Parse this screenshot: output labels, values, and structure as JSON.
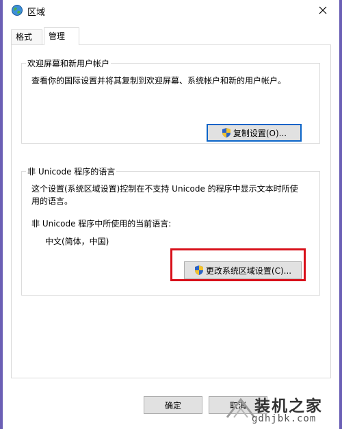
{
  "window": {
    "title": "区域"
  },
  "tabs": [
    {
      "label": "格式"
    },
    {
      "label": "管理"
    }
  ],
  "welcome_group": {
    "legend": "欢迎屏幕和新用户帐户",
    "description": "查看你的国际设置并将其复制到欢迎屏幕、系统帐户和新的用户帐户。",
    "copy_button": "复制设置(O)..."
  },
  "unicode_group": {
    "legend": "非 Unicode 程序的语言",
    "description_line1": "这个设置(系统区域设置)控制在不支持 Unicode 的程序中显示文本时所使",
    "description_line2": "用的语言。",
    "current_label": "非 Unicode 程序中所使用的当前语言:",
    "current_value": "中文(简体，中国)",
    "change_button": "更改系统区域设置(C)..."
  },
  "footer": {
    "ok": "确定",
    "cancel": "取消"
  },
  "watermark": {
    "title": "装机之家",
    "url": "gdhjbk.com"
  },
  "colors": {
    "highlight": "#d8101a",
    "focus": "#0a64c8",
    "background": "#6b5fb5"
  }
}
